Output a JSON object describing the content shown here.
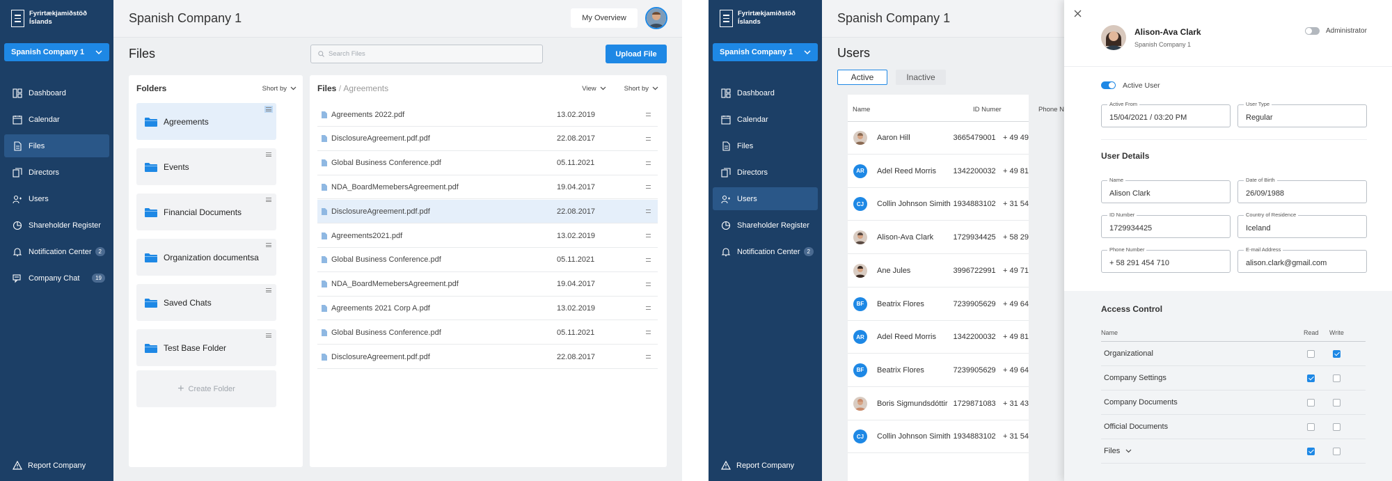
{
  "brand": {
    "name": "Fyrirtækjamiðstöð Íslands"
  },
  "company": {
    "selected": "Spanish Company 1",
    "title": "Spanish Company 1"
  },
  "nav": [
    {
      "label": "Dashboard",
      "icon": "dashboard-icon"
    },
    {
      "label": "Calendar",
      "icon": "calendar-icon"
    },
    {
      "label": "Files",
      "icon": "files-icon"
    },
    {
      "label": "Directors",
      "icon": "directors-icon"
    },
    {
      "label": "Users",
      "icon": "users-icon"
    },
    {
      "label": "Shareholder Register",
      "icon": "pie-chart-icon"
    },
    {
      "label": "Notification Center",
      "icon": "bell-icon",
      "badge": "2"
    },
    {
      "label": "Company Chat",
      "icon": "chat-icon",
      "badge": "19"
    }
  ],
  "report": {
    "label": "Report Company"
  },
  "header": {
    "overview_button": "My Overview"
  },
  "files_screen": {
    "title": "Files",
    "search_placeholder": "Search Files",
    "upload_button": "Upload File",
    "folders_title": "Folders",
    "sort_label": "Short by",
    "view_label": "View",
    "breadcrumb_root": "Files",
    "breadcrumb_sep": "/",
    "breadcrumb_current": "Agreements",
    "create_folder": "Create Folder",
    "folders": [
      {
        "name": "Agreements",
        "selected": true
      },
      {
        "name": "Events"
      },
      {
        "name": "Financial Documents"
      },
      {
        "name": "Organization documentsa"
      },
      {
        "name": "Saved Chats"
      },
      {
        "name": "Test Base Folder"
      }
    ],
    "files": [
      {
        "name": "Agreements 2022.pdf",
        "date": "13.02.2019"
      },
      {
        "name": "DisclosureAgreement.pdf.pdf",
        "date": "22.08.2017"
      },
      {
        "name": "Global Business Conference.pdf",
        "date": "05.11.2021"
      },
      {
        "name": "NDA_BoardMemebersAgreement.pdf",
        "date": "19.04.2017"
      },
      {
        "name": "DisclosureAgreement.pdf.pdf",
        "date": "22.08.2017",
        "selected": true
      },
      {
        "name": "Agreements2021.pdf",
        "date": "13.02.2019"
      },
      {
        "name": "Global Business Conference.pdf",
        "date": "05.11.2021"
      },
      {
        "name": "NDA_BoardMemebersAgreement.pdf",
        "date": "19.04.2017"
      },
      {
        "name": "Agreements 2021 Corp A.pdf",
        "date": "13.02.2019"
      },
      {
        "name": "Global Business Conference.pdf",
        "date": "05.11.2021"
      },
      {
        "name": "DisclosureAgreement.pdf.pdf",
        "date": "22.08.2017"
      }
    ]
  },
  "users_screen": {
    "title": "Users",
    "tabs": [
      {
        "label": "Active"
      },
      {
        "label": "Inactive"
      }
    ],
    "columns": {
      "name": "Name",
      "id": "ID Numer",
      "phone": "Phone N"
    },
    "users": [
      {
        "name": "Aaron Hill",
        "id": "3665479001",
        "phone": "+ 49 49",
        "avatar": "photo",
        "color": "#8a6a52"
      },
      {
        "name": "Adel Reed Morris",
        "id": "1342200032",
        "phone": "+ 49 81",
        "initials": "AR",
        "color": "#1e88e5"
      },
      {
        "name": "Collin Johnson Simith",
        "id": "1934883102",
        "phone": "+ 31 54",
        "initials": "CJ",
        "color": "#1e88e5"
      },
      {
        "name": "Alison-Ava Clark",
        "id": "1729934425",
        "phone": "+ 58 29",
        "avatar": "photo",
        "color": "#5a4a42"
      },
      {
        "name": "Ane Jules",
        "id": "3996722991",
        "phone": "+ 49 71",
        "avatar": "photo",
        "color": "#3a2a22"
      },
      {
        "name": "Beatrix Flores",
        "id": "7239905629",
        "phone": "+ 49 64",
        "initials": "BF",
        "color": "#1e88e5"
      },
      {
        "name": "Adel Reed Morris",
        "id": "1342200032",
        "phone": "+ 49 81",
        "initials": "AR",
        "color": "#1e88e5"
      },
      {
        "name": "Beatrix Flores",
        "id": "7239905629",
        "phone": "+ 49 64",
        "initials": "BF",
        "color": "#1e88e5"
      },
      {
        "name": "Boris Sigmundsdóttir",
        "id": "1729871083",
        "phone": "+ 31 43",
        "avatar": "photo",
        "color": "#c98a6a"
      },
      {
        "name": "Collin Johnson Simith",
        "id": "1934883102",
        "phone": "+ 31 54",
        "initials": "CJ",
        "color": "#1e88e5"
      }
    ]
  },
  "drawer": {
    "name": "Alison-Ava Clark",
    "company": "Spanish Company 1",
    "admin_label": "Administrator",
    "admin_on": false,
    "active_label": "Active User",
    "active_on": true,
    "active_from_label": "Active From",
    "active_from": "15/04/2021 / 03:20 PM",
    "user_type_label": "User Type",
    "user_type": "Regular",
    "details_title": "User Details",
    "name_label": "Name",
    "name_value": "Alison Clark",
    "dob_label": "Date of Birth",
    "dob": "26/09/1988",
    "id_label": "ID Number",
    "id_value": "1729934425",
    "country_label": "Country of Residence",
    "country": "Iceland",
    "phone_label": "Phone Number",
    "phone": "+ 58 291 454 710",
    "email_label": "E-mail Address",
    "email": "alison.clark@gmail.com",
    "access_title": "Access Control",
    "access_cols": {
      "name": "Name",
      "read": "Read",
      "write": "Write"
    },
    "access": [
      {
        "name": "Organizational",
        "read": false,
        "write": true
      },
      {
        "name": "Company Settings",
        "read": true,
        "write": false
      },
      {
        "name": "Company Documents",
        "read": false,
        "write": false
      },
      {
        "name": "Official Documents",
        "read": false,
        "write": false
      },
      {
        "name": "Files",
        "read": true,
        "write": false,
        "expandable": true
      }
    ]
  },
  "colors": {
    "sidebar": "#1c3f66",
    "accent": "#1e88e5",
    "selected": "#e5effa"
  }
}
